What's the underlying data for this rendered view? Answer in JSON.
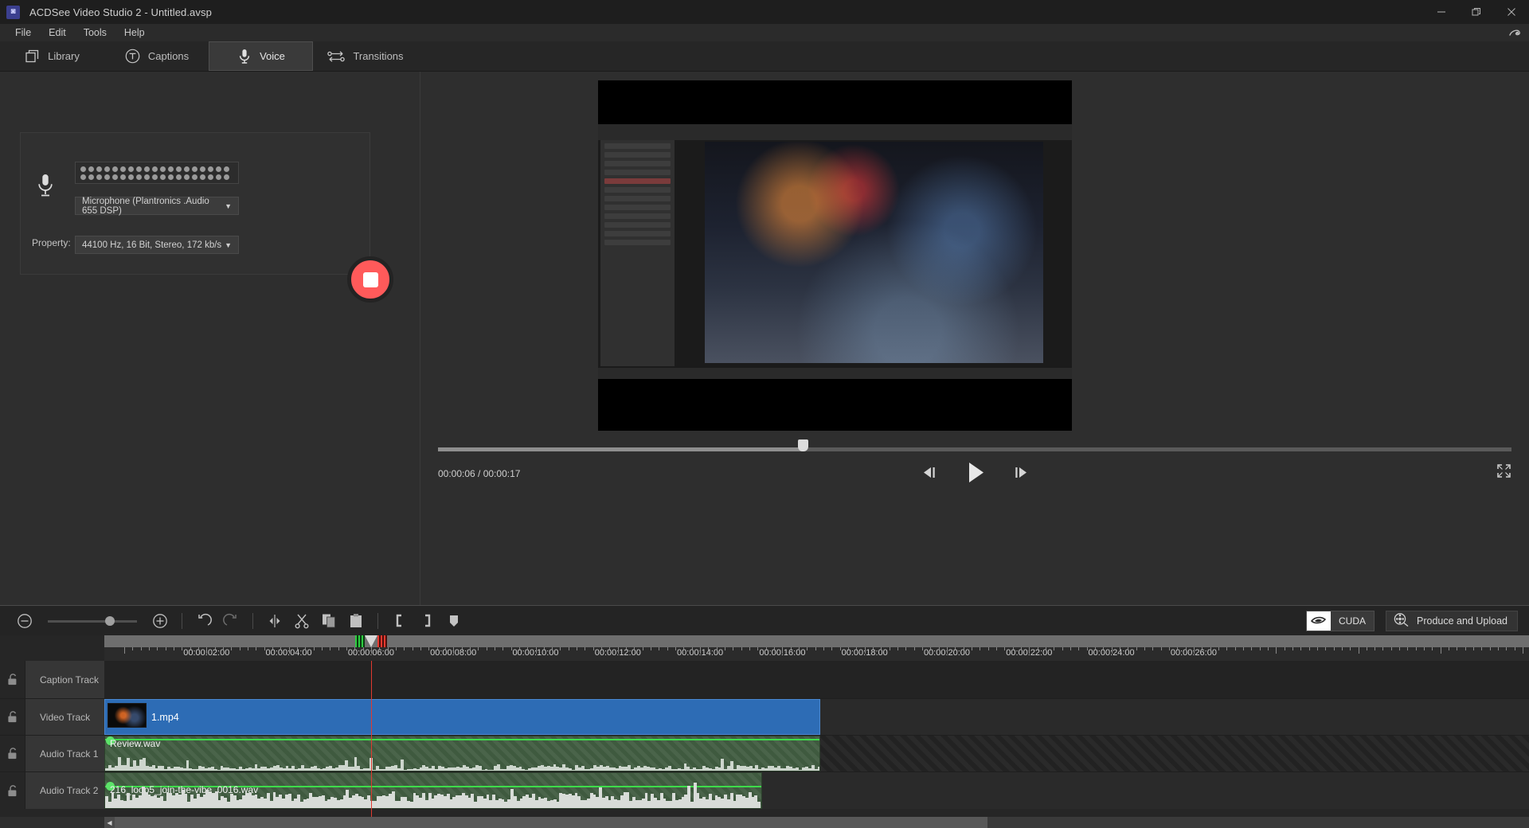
{
  "window": {
    "app_icon": "app-logo-icon",
    "title": "ACDSee Video Studio 2 - Untitled.avsp",
    "minimize": "—",
    "restore": "❐",
    "close": "✕"
  },
  "menubar": {
    "items": [
      {
        "label": "File"
      },
      {
        "label": "Edit"
      },
      {
        "label": "Tools"
      },
      {
        "label": "Help"
      }
    ],
    "right_icon": "settings-swirl-icon"
  },
  "tabs": [
    {
      "label": "Library",
      "icon": "layers-icon",
      "active": false
    },
    {
      "label": "Captions",
      "icon": "text-circle-icon",
      "active": false
    },
    {
      "label": "Voice",
      "icon": "microphone-icon",
      "active": true
    },
    {
      "label": "Transitions",
      "icon": "transitions-icon",
      "active": false
    }
  ],
  "voice_panel": {
    "mic_icon": "microphone-icon",
    "level_meter_leds": 19,
    "device": {
      "value": "Microphone (Plantronics .Audio 655 DSP)",
      "caret": "▼"
    },
    "property": {
      "label": "Property:",
      "value": "44100 Hz, 16 Bit, Stereo, 172 kb/s",
      "caret": "▼"
    },
    "record_button": {
      "name": "stop-recording-button",
      "state": "recording",
      "color": "#ff5a5a"
    }
  },
  "preview": {
    "timecode": "00:00:06 / 00:00:17",
    "scrub_percent": 34,
    "controls": [
      {
        "name": "step-back-button",
        "icon": "previous-frame-icon"
      },
      {
        "name": "play-button",
        "icon": "play-icon"
      },
      {
        "name": "step-forward-button",
        "icon": "next-frame-icon"
      }
    ],
    "fullscreen": "fullscreen-icon"
  },
  "timeline_toolbar": {
    "left_icons": [
      {
        "name": "zoom-out-button",
        "icon": "minus-circle-icon"
      },
      {
        "name": "zoom-in-button",
        "icon": "plus-circle-icon"
      },
      {
        "name": "undo-button",
        "icon": "undo-icon"
      },
      {
        "name": "redo-button",
        "icon": "redo-icon"
      },
      {
        "name": "split-button",
        "icon": "split-icon"
      },
      {
        "name": "cut-button",
        "icon": "scissors-icon"
      },
      {
        "name": "copy-button",
        "icon": "copy-icon"
      },
      {
        "name": "paste-button",
        "icon": "paste-icon"
      },
      {
        "name": "mark-in-button",
        "icon": "bracket-left-icon"
      },
      {
        "name": "mark-out-button",
        "icon": "bracket-right-icon"
      },
      {
        "name": "marker-button",
        "icon": "marker-icon"
      }
    ],
    "zoom_slider_percent": 70,
    "cuda_label": "CUDA",
    "produce_label": "Produce and Upload"
  },
  "timeline": {
    "ruler_ticks": [
      "00:00:02:00",
      "00:00:04:00",
      "00:00:06:00",
      "00:00:08:00",
      "00:00:10:00",
      "00:00:12:00",
      "00:00:14:00",
      "00:00:16:00",
      "00:00:18:00",
      "00:00:20:00",
      "00:00:22:00",
      "00:00:24:00",
      "00:00:26:00"
    ],
    "playhead_time": "00:00:06:00",
    "tracks": [
      {
        "name": "Caption Track",
        "lock": "unlocked-icon",
        "clip": null
      },
      {
        "name": "Video Track",
        "lock": "unlocked-icon",
        "clip": "1.mp4"
      },
      {
        "name": "Audio Track 1",
        "lock": "unlocked-icon",
        "clip": "Review.wav"
      },
      {
        "name": "Audio Track 2",
        "lock": "unlocked-icon",
        "clip": "216_loop5_join-the-vibe_0016.wav"
      }
    ],
    "scroll_arrow": "◀"
  }
}
